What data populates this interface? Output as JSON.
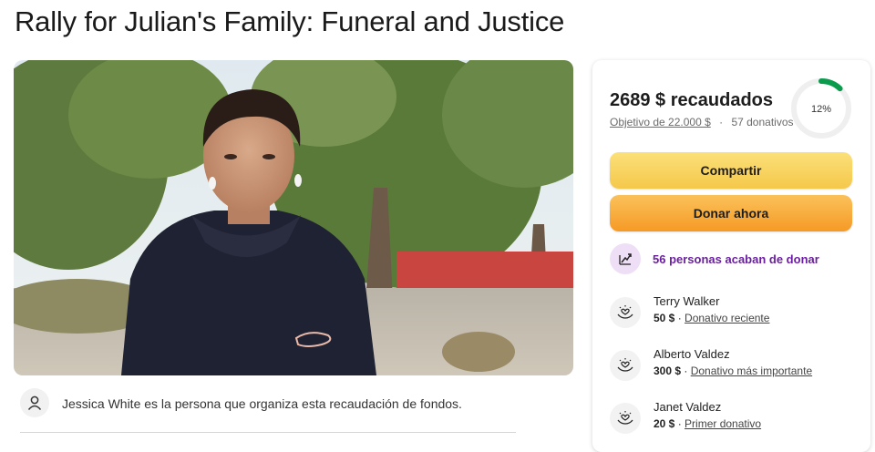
{
  "page": {
    "title": "Rally for Julian's Family: Funeral and Justice"
  },
  "organizer": {
    "text": "Jessica White es la persona que organiza esta recaudación de fondos."
  },
  "progress": {
    "raised_amount": "2689 $",
    "raised_suffix": " recaudados",
    "goal_text": "Objetivo de 22.000 $",
    "separator": "·",
    "donations_count": "57 donativos",
    "percent_label": "12%",
    "percent_value": 12,
    "accent_color": "#0a9b4c"
  },
  "actions": {
    "share_label": "Compartir",
    "donate_label": "Donar ahora"
  },
  "recent_activity": {
    "text": "56 personas acaban de donar",
    "icon": "trending-up-icon"
  },
  "donors": [
    {
      "name": "Terry Walker",
      "amount": "50 $",
      "tag": "Donativo reciente",
      "icon": "heart-hands-icon"
    },
    {
      "name": "Alberto Valdez",
      "amount": "300 $",
      "tag": "Donativo más importante",
      "icon": "heart-hands-icon"
    },
    {
      "name": "Janet Valdez",
      "amount": "20 $",
      "tag": "Primer donativo",
      "icon": "heart-hands-icon"
    }
  ],
  "colors": {
    "share_button": "#f8d45f",
    "donate_button": "#f7a93a",
    "recent_text": "#6b1fa0"
  }
}
